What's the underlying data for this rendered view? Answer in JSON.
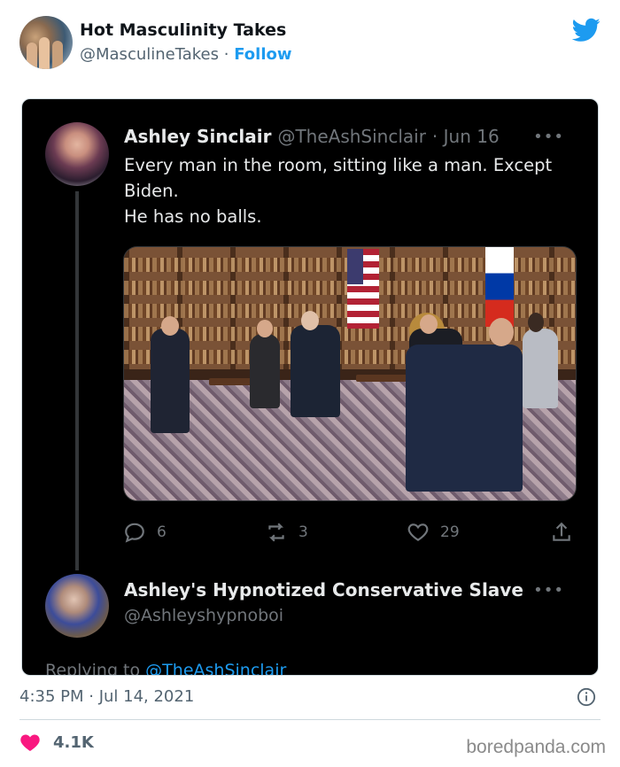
{
  "outer_tweet": {
    "display_name": "Hot Masculinity Takes",
    "handle": "@MasculineTakes",
    "separator": "·",
    "follow_label": "Follow",
    "logo_icon": "twitter-bird-icon",
    "accent_color": "#1d9bf0",
    "timestamp": "4:35 PM · Jul 14, 2021",
    "like_count": "4.1K",
    "like_color": "#f91880"
  },
  "embedded_screenshot": {
    "tweet": {
      "display_name": "Ashley Sinclair",
      "handle": "@TheAshSinclair",
      "date": "· Jun 16",
      "more_icon": "•••",
      "text_lines": [
        "Every man in the room, sitting like a man. Except Biden.",
        "He has no balls."
      ],
      "reply_count": "6",
      "retweet_count": "3",
      "like_count": "29"
    },
    "reply": {
      "display_name": "Ashley's Hypnotized Conservative Slave",
      "handle": "@Ashleyshypnoboi",
      "more_icon": "•••",
      "replying_prefix": "Replying to",
      "replying_to": "@TheAshSinclair"
    }
  },
  "watermark": "boredpanda.com"
}
